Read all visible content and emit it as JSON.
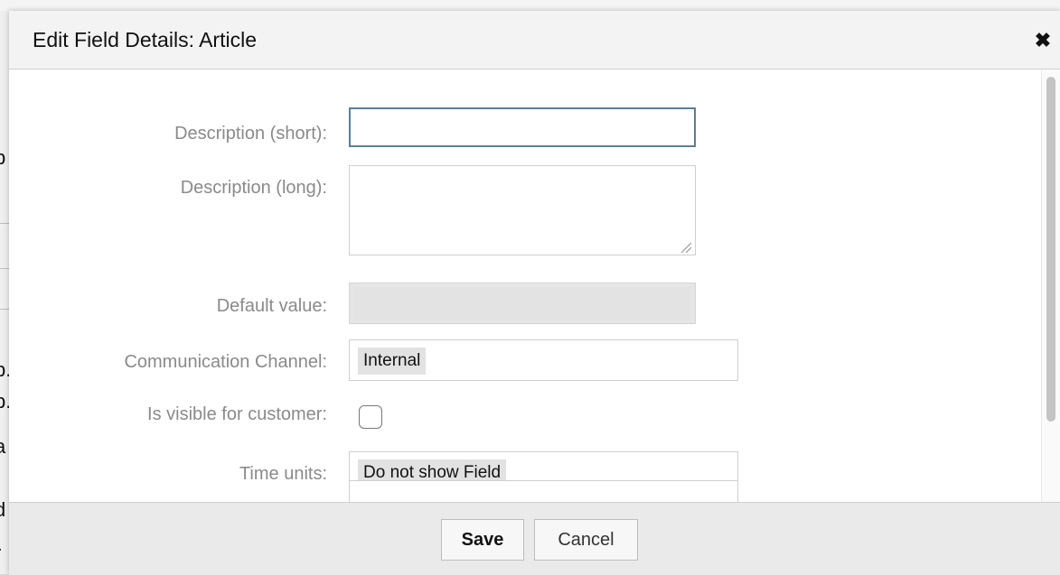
{
  "dialog": {
    "title": "Edit Field Details: Article",
    "close_icon": "close-icon"
  },
  "form": {
    "description_short": {
      "label": "Description (short):",
      "value": ""
    },
    "description_long": {
      "label": "Description (long):",
      "value": ""
    },
    "default_value": {
      "label": "Default value:",
      "value": ""
    },
    "communication_channel": {
      "label": "Communication Channel:",
      "selected": "Internal"
    },
    "is_visible_for_customer": {
      "label": "Is visible for customer:",
      "checked": false
    },
    "time_units": {
      "label": "Time units:",
      "selected": "Do not show Field"
    }
  },
  "footer": {
    "save_label": "Save",
    "cancel_label": "Cancel"
  },
  "background": {
    "left_chars": [
      "p",
      "p.",
      "p.",
      "a",
      "d",
      "r"
    ]
  },
  "colors": {
    "focus_border": "#5a7f94",
    "header_bg": "#f3f3f3",
    "footer_bg": "#eaeaea",
    "label_text": "#8a8a8a"
  }
}
